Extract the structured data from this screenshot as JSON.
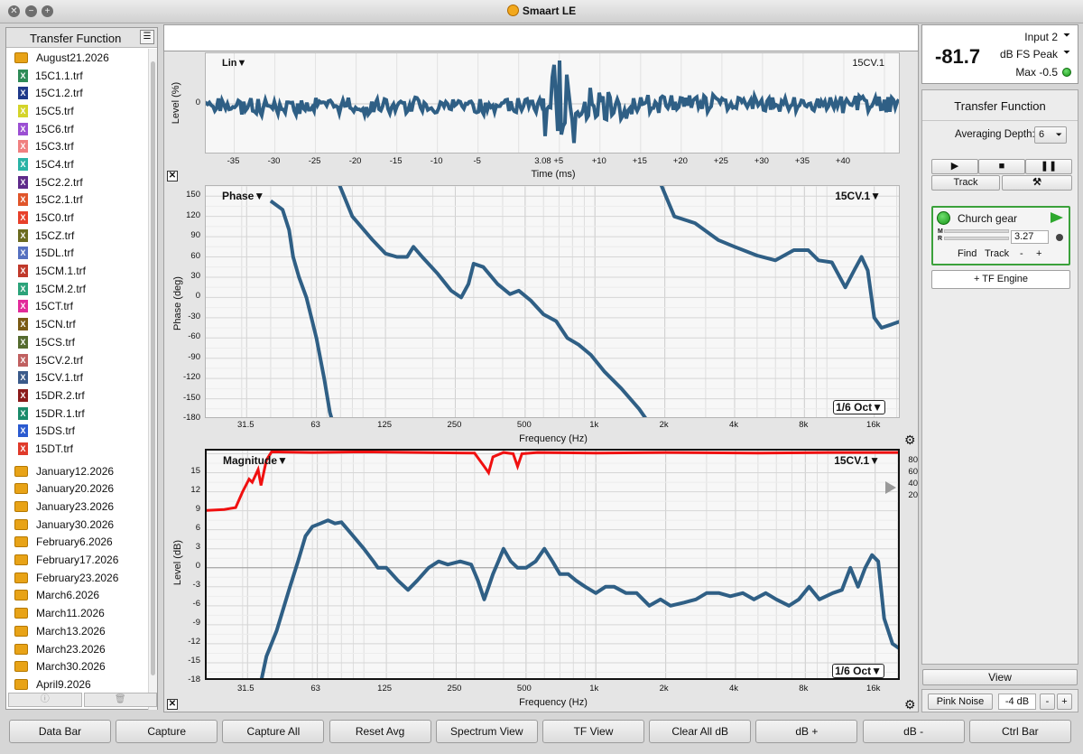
{
  "app": {
    "title": "Smaart LE"
  },
  "sidebar": {
    "title": "Transfer Function",
    "open_folder": "August21.2026",
    "files": [
      {
        "name": "15C1.1.trf",
        "color": "#2e8b57"
      },
      {
        "name": "15C1.2.trf",
        "color": "#1f3a8a"
      },
      {
        "name": "15C5.trf",
        "color": "#d4d42a"
      },
      {
        "name": "15C6.trf",
        "color": "#9b4fd3"
      },
      {
        "name": "15C3.trf",
        "color": "#f08080"
      },
      {
        "name": "15C4.trf",
        "color": "#2ab3a6"
      },
      {
        "name": "15C2.2.trf",
        "color": "#5e2a8a"
      },
      {
        "name": "15C2.1.trf",
        "color": "#e0552a"
      },
      {
        "name": "15C0.trf",
        "color": "#e8402a"
      },
      {
        "name": "15CZ.trf",
        "color": "#6b6b1f"
      },
      {
        "name": "15DL.trf",
        "color": "#5570c0"
      },
      {
        "name": "15CM.1.trf",
        "color": "#c0392b"
      },
      {
        "name": "15CM.2.trf",
        "color": "#2ca37a"
      },
      {
        "name": "15CT.trf",
        "color": "#e22b9a"
      },
      {
        "name": "15CN.trf",
        "color": "#7a5a14"
      },
      {
        "name": "15CS.trf",
        "color": "#556b2f"
      },
      {
        "name": "15CV.2.trf",
        "color": "#c06060"
      },
      {
        "name": "15CV.1.trf",
        "color": "#3a5a8a"
      },
      {
        "name": "15DR.2.trf",
        "color": "#8b1a1a"
      },
      {
        "name": "15DR.1.trf",
        "color": "#1a8a6a"
      },
      {
        "name": "15DS.trf",
        "color": "#2a5ad0"
      },
      {
        "name": "15DT.trf",
        "color": "#e03a2a"
      }
    ],
    "folders": [
      "January12.2026",
      "January20.2026",
      "January23.2026",
      "January30.2026",
      "February6.2026",
      "February17.2026",
      "February23.2026",
      "March6.2026",
      "March11.2026",
      "March13.2026",
      "March23.2026",
      "March30.2026",
      "April9.2026"
    ],
    "footer": [
      "ⓘ",
      "🗑"
    ]
  },
  "impulse": {
    "mode_label": "Lin▼",
    "trace_label": "15CV.1",
    "ylabel": "Level (%)",
    "xlabel": "Time (ms)",
    "ytick": "0",
    "xticks": [
      "-35",
      "-30",
      "-25",
      "-20",
      "-15",
      "-10",
      "-5",
      "3.08",
      "+5",
      "+10",
      "+15",
      "+20",
      "+25",
      "+30",
      "+35",
      "+40"
    ]
  },
  "phase": {
    "title": "Phase▼",
    "trace_label": "15CV.1▼",
    "ylabel": "Phase (deg)",
    "xlabel": "Frequency (Hz)",
    "smoothing": "1/6 Oct▼",
    "yticks": [
      "150",
      "120",
      "90",
      "60",
      "30",
      "0",
      "-30",
      "-60",
      "-90",
      "-120",
      "-150",
      "-180"
    ]
  },
  "magnitude": {
    "title": "Magnitude▼",
    "trace_label": "15CV.1▼",
    "ylabel": "Level (dB)",
    "xlabel": "Frequency (Hz)",
    "smoothing": "1/6 Oct▼",
    "yticks": [
      "15",
      "12",
      "9",
      "6",
      "3",
      "0",
      "-3",
      "-6",
      "-9",
      "-12",
      "-15",
      "-18"
    ],
    "coh_ticks": [
      "80",
      "60",
      "40",
      "20"
    ]
  },
  "freq_ticks": [
    "31.5",
    "63",
    "125",
    "250",
    "500",
    "1k",
    "2k",
    "4k",
    "8k",
    "16k"
  ],
  "meter": {
    "value": "-81.7",
    "input": "Input 2",
    "mode": "dB FS Peak",
    "max": "Max -0.5"
  },
  "tf_panel": {
    "title": "Transfer Function",
    "avg_label": "Averaging Depth:",
    "avg_value": "6",
    "track_btn": "Track",
    "tools_icon": "⚒",
    "engine": {
      "name": "Church gear",
      "delay": "3.27",
      "find": "Find",
      "track": "Track",
      "minus": "-",
      "plus": "+",
      "m": "M",
      "r": "R"
    },
    "add_engine": "+ TF Engine"
  },
  "view_btn": "View",
  "generator": {
    "label": "Pink Noise",
    "level": "-4 dB",
    "minus": "-",
    "plus": "+"
  },
  "bottom_buttons": [
    "Data Bar",
    "Capture",
    "Capture All",
    "Reset Avg",
    "Spectrum View",
    "TF View",
    "Clear All dB",
    "dB +",
    "dB -",
    "Ctrl Bar"
  ]
}
